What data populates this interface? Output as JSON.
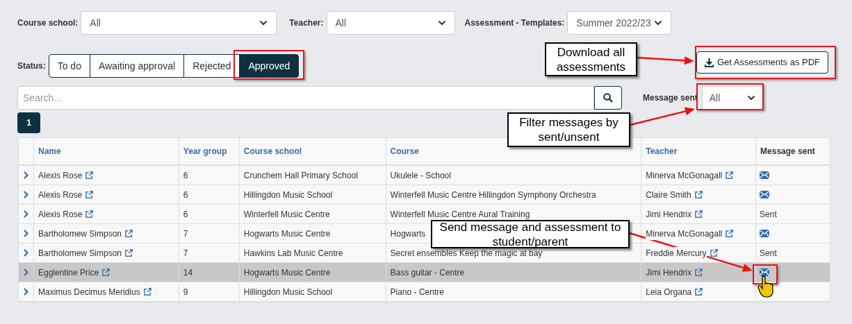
{
  "filters": [
    {
      "label": "Course school:",
      "value": "All"
    },
    {
      "label": "Teacher:",
      "value": "All"
    },
    {
      "label": "Assessment - Templates:",
      "value": "Summer 2022/23"
    }
  ],
  "status": {
    "label": "Status:",
    "tabs": [
      {
        "label": "To do",
        "selected": false
      },
      {
        "label": "Awaiting approval",
        "selected": false
      },
      {
        "label": "Rejected",
        "selected": false
      },
      {
        "label": "Approved",
        "selected": true
      }
    ]
  },
  "pdf_button": "Get Assessments as PDF",
  "search": {
    "placeholder": "Search..."
  },
  "message_filter": {
    "label": "Message sent",
    "value": "All"
  },
  "pages": [
    {
      "label": "1",
      "selected": true
    }
  ],
  "table": {
    "columns": [
      "Name",
      "Year group",
      "Course school",
      "Course",
      "Teacher",
      "Message sent"
    ],
    "rows": [
      {
        "name": "Alexis Rose",
        "year": "6",
        "school": "Crunchem Hall Primary School",
        "course": "Ukulele - School",
        "teacher": "Minerva McGonagall",
        "message": {
          "kind": "icon"
        },
        "selected": false
      },
      {
        "name": "Alexis Rose",
        "year": "6",
        "school": "Hillingdon Music School",
        "course": "Winterfell Music Centre Hillingdon Symphony Orchestra",
        "teacher": "Claire Smith",
        "message": {
          "kind": "icon"
        },
        "selected": false
      },
      {
        "name": "Alexis Rose",
        "year": "6",
        "school": "Winterfell Music Centre",
        "course": "Winterfell Music Centre Aural Training",
        "teacher": "Jimi Hendrix",
        "message": {
          "kind": "text",
          "text": "Sent"
        },
        "selected": false
      },
      {
        "name": "Bartholomew Simpson",
        "year": "7",
        "school": "Hogwarts Music Centre",
        "course": "Hogwarts",
        "teacher": "Minerva McGonagall",
        "message": {
          "kind": "icon"
        },
        "selected": false
      },
      {
        "name": "Bartholomew Simpson",
        "year": "7",
        "school": "Hawkins Lab Music Centre",
        "course": "Secret ensembles Keep the magic at bay",
        "teacher": "Freddie Mercury",
        "message": {
          "kind": "text",
          "text": "Sent"
        },
        "selected": false
      },
      {
        "name": "Egglentine Price",
        "year": "14",
        "school": "Hogwarts Music Centre",
        "course": "Bass guitar - Centre",
        "teacher": "Jimi Hendrix",
        "message": {
          "kind": "icon"
        },
        "selected": true
      },
      {
        "name": "Maximus Decimus Meridius",
        "year": "9",
        "school": "Hillingdon Music School",
        "course": "Piano - Centre",
        "teacher": "Leia Organa",
        "message": {
          "kind": "none"
        },
        "selected": false
      }
    ]
  },
  "callouts": [
    {
      "text": "Download all assessments"
    },
    {
      "text": "Filter messages by sent/unsent"
    },
    {
      "text": "Send message and assessment to student/parent"
    }
  ]
}
